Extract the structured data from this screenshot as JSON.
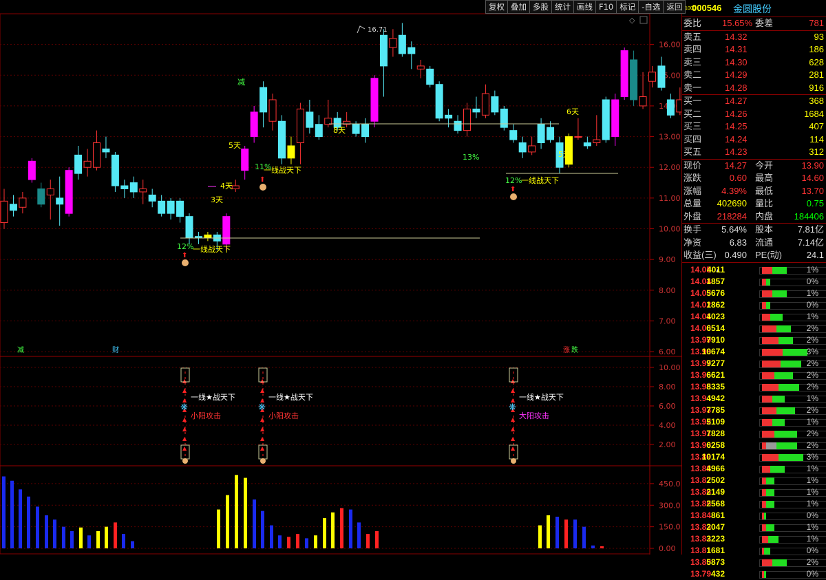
{
  "toolbar": [
    "复权",
    "叠加",
    "多股",
    "统计",
    "画线",
    "F10",
    "标记",
    "-自选",
    "返回"
  ],
  "chart": {
    "peak_label": "16.71",
    "price_axis": [
      "16.00",
      "15.00",
      "14.00",
      "13.00",
      "12.00",
      "11.00",
      "10.00",
      "9.00",
      "8.00",
      "7.00",
      "6.00"
    ],
    "annotations": [
      {
        "text": "12%",
        "color": "#4f4"
      },
      {
        "text": "一线战天下",
        "color": "#ff0"
      },
      {
        "text": "3天",
        "color": "#ff0"
      },
      {
        "text": "4天",
        "color": "#ff0"
      },
      {
        "text": "5天",
        "color": "#ff0"
      },
      {
        "text": "减",
        "color": "#4f4"
      },
      {
        "text": "11%",
        "color": "#4f4"
      },
      {
        "text": "一线战天下",
        "color": "#ff0"
      },
      {
        "text": "8天",
        "color": "#ff0"
      },
      {
        "text": "13%",
        "color": "#4f4"
      },
      {
        "text": "12%",
        "color": "#4f4"
      },
      {
        "text": "一线战天下",
        "color": "#ff0"
      },
      {
        "text": "5天",
        "color": "#ff0"
      },
      {
        "text": "6天",
        "color": "#ff0"
      }
    ],
    "bottom_markers": [
      {
        "text": "减",
        "color": "#4f4"
      },
      {
        "text": "财",
        "color": "#4cf"
      },
      {
        "text": "涨",
        "color": "#f33"
      },
      {
        "text": "跌",
        "color": "#4f4"
      }
    ],
    "indicator_axis": [
      "10.00",
      "8.00",
      "6.00",
      "4.00",
      "2.00"
    ],
    "signals": [
      {
        "line": "一线★战天下",
        "attack": "小阳攻击",
        "attack_color": "#f33"
      },
      {
        "line": "一线★战天下",
        "attack": "小阳攻击",
        "attack_color": "#f33"
      },
      {
        "line": "一线★战天下",
        "attack": "大阳攻击",
        "attack_color": "#f3f"
      }
    ],
    "volume_axis": [
      "450.0",
      "300.0",
      "150.0",
      "0.00"
    ]
  },
  "chart_data": {
    "type": "candlestick",
    "price_range": [
      5.8,
      17.0
    ],
    "candles": [
      {
        "o": 10.2,
        "c": 10.9,
        "h": 11.3,
        "l": 10.0,
        "k": "up"
      },
      {
        "o": 10.6,
        "c": 10.8,
        "h": 11.1,
        "l": 10.4,
        "k": "down"
      },
      {
        "o": 10.7,
        "c": 11.0,
        "h": 11.2,
        "l": 10.5,
        "k": "up"
      },
      {
        "o": 11.6,
        "c": 12.2,
        "h": 12.3,
        "l": 11.5,
        "k": "mag"
      },
      {
        "o": 11.3,
        "c": 10.8,
        "h": 11.5,
        "l": 10.7,
        "k": "teal"
      },
      {
        "o": 11.1,
        "c": 11.3,
        "h": 11.6,
        "l": 10.3,
        "k": "up"
      },
      {
        "o": 10.8,
        "c": 11.0,
        "h": 11.7,
        "l": 10.1,
        "k": "down"
      },
      {
        "o": 10.5,
        "c": 11.9,
        "h": 12.0,
        "l": 10.4,
        "k": "mag"
      },
      {
        "o": 11.8,
        "c": 12.4,
        "h": 12.7,
        "l": 11.6,
        "k": "down"
      },
      {
        "o": 12.2,
        "c": 12.0,
        "h": 12.6,
        "l": 11.7,
        "k": "up"
      },
      {
        "o": 12.0,
        "c": 12.8,
        "h": 13.2,
        "l": 11.9,
        "k": "up"
      },
      {
        "o": 12.5,
        "c": 12.6,
        "h": 13.0,
        "l": 12.3,
        "k": "down"
      },
      {
        "o": 12.4,
        "c": 11.4,
        "h": 12.5,
        "l": 11.2,
        "k": "down"
      },
      {
        "o": 11.3,
        "c": 11.4,
        "h": 11.6,
        "l": 11.0,
        "k": "down"
      },
      {
        "o": 11.2,
        "c": 11.5,
        "h": 11.7,
        "l": 11.0,
        "k": "down"
      },
      {
        "o": 11.3,
        "c": 11.2,
        "h": 11.6,
        "l": 10.8,
        "k": "up"
      },
      {
        "o": 11.1,
        "c": 10.9,
        "h": 11.3,
        "l": 10.7,
        "k": "down"
      },
      {
        "o": 10.9,
        "c": 10.5,
        "h": 11.1,
        "l": 10.4,
        "k": "down"
      },
      {
        "o": 10.5,
        "c": 10.9,
        "h": 11.0,
        "l": 10.3,
        "k": "down"
      },
      {
        "o": 10.9,
        "c": 10.4,
        "h": 11.0,
        "l": 10.2,
        "k": "down"
      },
      {
        "o": 10.4,
        "c": 9.7,
        "h": 10.5,
        "l": 9.5,
        "k": "down"
      },
      {
        "o": 9.7,
        "c": 9.75,
        "h": 9.9,
        "l": 9.5,
        "k": "down"
      },
      {
        "o": 9.7,
        "c": 9.8,
        "h": 9.9,
        "l": 9.6,
        "k": "yel"
      },
      {
        "o": 9.8,
        "c": 9.6,
        "h": 9.9,
        "l": 9.3,
        "k": "down"
      },
      {
        "o": 9.5,
        "c": 10.4,
        "h": 10.5,
        "l": 9.3,
        "k": "mag"
      },
      {
        "o": 11.3,
        "c": 11.4,
        "h": 11.6,
        "l": 11.2,
        "k": "up"
      },
      {
        "o": 11.9,
        "c": 12.6,
        "h": 12.7,
        "l": 11.6,
        "k": "mag"
      },
      {
        "o": 13.0,
        "c": 13.8,
        "h": 14.0,
        "l": 12.8,
        "k": "mag"
      },
      {
        "o": 13.8,
        "c": 14.6,
        "h": 14.8,
        "l": 13.3,
        "k": "down"
      },
      {
        "o": 14.2,
        "c": 13.5,
        "h": 14.4,
        "l": 13.2,
        "k": "up"
      },
      {
        "o": 13.5,
        "c": 12.3,
        "h": 13.7,
        "l": 12.1,
        "k": "down"
      },
      {
        "o": 12.3,
        "c": 12.7,
        "h": 13.0,
        "l": 12.1,
        "k": "yel"
      },
      {
        "o": 12.8,
        "c": 13.9,
        "h": 14.1,
        "l": 12.1,
        "k": "up"
      },
      {
        "o": 13.8,
        "c": 13.3,
        "h": 14.2,
        "l": 13.1,
        "k": "down"
      },
      {
        "o": 13.0,
        "c": 13.4,
        "h": 13.7,
        "l": 12.9,
        "k": "down"
      },
      {
        "o": 13.6,
        "c": 13.4,
        "h": 14.2,
        "l": 13.3,
        "k": "up"
      },
      {
        "o": 13.3,
        "c": 13.6,
        "h": 13.8,
        "l": 13.2,
        "k": "down"
      },
      {
        "o": 13.5,
        "c": 13.4,
        "h": 13.8,
        "l": 13.3,
        "k": "up"
      },
      {
        "o": 13.1,
        "c": 13.4,
        "h": 13.5,
        "l": 13.0,
        "k": "down"
      },
      {
        "o": 13.4,
        "c": 13.0,
        "h": 13.6,
        "l": 12.8,
        "k": "down"
      },
      {
        "o": 13.5,
        "c": 14.9,
        "h": 15.0,
        "l": 13.3,
        "k": "mag"
      },
      {
        "o": 15.3,
        "c": 16.3,
        "h": 16.5,
        "l": 14.3,
        "k": "down"
      },
      {
        "o": 15.9,
        "c": 16.2,
        "h": 16.5,
        "l": 15.6,
        "k": "up"
      },
      {
        "o": 16.3,
        "c": 15.7,
        "h": 16.7,
        "l": 15.6,
        "k": "down"
      },
      {
        "o": 15.7,
        "c": 15.9,
        "h": 16.1,
        "l": 15.2,
        "k": "down"
      },
      {
        "o": 15.3,
        "c": 15.2,
        "h": 15.5,
        "l": 14.9,
        "k": "up"
      },
      {
        "o": 15.2,
        "c": 14.7,
        "h": 15.3,
        "l": 14.6,
        "k": "down"
      },
      {
        "o": 14.7,
        "c": 13.6,
        "h": 14.8,
        "l": 13.5,
        "k": "down"
      },
      {
        "o": 13.6,
        "c": 13.7,
        "h": 13.9,
        "l": 13.3,
        "k": "down"
      },
      {
        "o": 13.5,
        "c": 13.2,
        "h": 13.7,
        "l": 13.1,
        "k": "down"
      },
      {
        "o": 13.2,
        "c": 13.9,
        "h": 14.1,
        "l": 13.0,
        "k": "up"
      },
      {
        "o": 13.8,
        "c": 13.9,
        "h": 14.3,
        "l": 13.6,
        "k": "down"
      },
      {
        "o": 13.7,
        "c": 14.4,
        "h": 14.7,
        "l": 13.6,
        "k": "up"
      },
      {
        "o": 14.3,
        "c": 13.8,
        "h": 14.5,
        "l": 13.7,
        "k": "down"
      },
      {
        "o": 13.9,
        "c": 13.3,
        "h": 14.0,
        "l": 13.2,
        "k": "down"
      },
      {
        "o": 13.2,
        "c": 12.9,
        "h": 13.4,
        "l": 12.8,
        "k": "down"
      },
      {
        "o": 12.8,
        "c": 12.5,
        "h": 13.0,
        "l": 12.3,
        "k": "down"
      },
      {
        "o": 12.5,
        "c": 12.7,
        "h": 13.0,
        "l": 12.4,
        "k": "up"
      },
      {
        "o": 12.8,
        "c": 13.4,
        "h": 13.6,
        "l": 12.6,
        "k": "down"
      },
      {
        "o": 13.3,
        "c": 12.9,
        "h": 13.5,
        "l": 12.8,
        "k": "down"
      },
      {
        "o": 12.8,
        "c": 12.0,
        "h": 13.0,
        "l": 11.8,
        "k": "down"
      },
      {
        "o": 12.1,
        "c": 13.0,
        "h": 13.1,
        "l": 12.0,
        "k": "yel"
      },
      {
        "o": 13.0,
        "c": 13.0,
        "h": 13.6,
        "l": 12.9,
        "k": "up"
      },
      {
        "o": 12.8,
        "c": 12.7,
        "h": 13.0,
        "l": 12.6,
        "k": "down"
      },
      {
        "o": 12.8,
        "c": 12.9,
        "h": 13.7,
        "l": 12.7,
        "k": "up"
      },
      {
        "o": 12.9,
        "c": 14.2,
        "h": 14.3,
        "l": 12.8,
        "k": "down"
      },
      {
        "o": 13.0,
        "c": 14.2,
        "h": 14.4,
        "l": 12.7,
        "k": "mag"
      },
      {
        "o": 14.3,
        "c": 15.8,
        "h": 15.9,
        "l": 14.2,
        "k": "mag"
      },
      {
        "o": 15.5,
        "c": 14.2,
        "h": 15.8,
        "l": 14.0,
        "k": "teal"
      },
      {
        "o": 14.0,
        "c": 14.3,
        "h": 15.1,
        "l": 13.9,
        "k": "up"
      },
      {
        "o": 14.8,
        "c": 15.1,
        "h": 15.3,
        "l": 14.6,
        "k": "up"
      },
      {
        "o": 14.6,
        "c": 15.3,
        "h": 15.6,
        "l": 14.5,
        "k": "down"
      },
      {
        "o": 14.2,
        "c": 13.7,
        "h": 14.4,
        "l": 13.6,
        "k": "down"
      },
      {
        "o": 13.8,
        "c": 14.2,
        "h": 14.6,
        "l": 13.7,
        "k": "up"
      }
    ],
    "volume_range": [
      0,
      550
    ],
    "volume": [
      {
        "v": 500,
        "c": "blue"
      },
      {
        "v": 470,
        "c": "blue"
      },
      {
        "v": 410,
        "c": "blue"
      },
      {
        "v": 360,
        "c": "blue"
      },
      {
        "v": 290,
        "c": "blue"
      },
      {
        "v": 230,
        "c": "blue"
      },
      {
        "v": 200,
        "c": "blue"
      },
      {
        "v": 150,
        "c": "blue"
      },
      {
        "v": 120,
        "c": "blue"
      },
      {
        "v": 145,
        "c": "yel"
      },
      {
        "v": 90,
        "c": "blue"
      },
      {
        "v": 120,
        "c": "yel"
      },
      {
        "v": 150,
        "c": "yel"
      },
      {
        "v": 180,
        "c": "red"
      },
      {
        "v": 100,
        "c": "blue"
      },
      {
        "v": 50,
        "c": "blue"
      },
      {
        "v": 270,
        "c": "yel"
      },
      {
        "v": 370,
        "c": "yel"
      },
      {
        "v": 510,
        "c": "yel"
      },
      {
        "v": 490,
        "c": "yel"
      },
      {
        "v": 340,
        "c": "blue"
      },
      {
        "v": 260,
        "c": "blue"
      },
      {
        "v": 160,
        "c": "blue"
      },
      {
        "v": 90,
        "c": "blue"
      },
      {
        "v": 80,
        "c": "red"
      },
      {
        "v": 100,
        "c": "red"
      },
      {
        "v": 70,
        "c": "blue"
      },
      {
        "v": 90,
        "c": "yel"
      },
      {
        "v": 210,
        "c": "yel"
      },
      {
        "v": 250,
        "c": "yel"
      },
      {
        "v": 280,
        "c": "red"
      },
      {
        "v": 270,
        "c": "blue"
      },
      {
        "v": 180,
        "c": "blue"
      },
      {
        "v": 100,
        "c": "red"
      },
      {
        "v": 120,
        "c": "red"
      },
      {
        "v": 160,
        "c": "yel"
      },
      {
        "v": 230,
        "c": "yel"
      },
      {
        "v": 220,
        "c": "blue"
      },
      {
        "v": 200,
        "c": "red"
      },
      {
        "v": 200,
        "c": "blue"
      },
      {
        "v": 150,
        "c": "blue"
      },
      {
        "v": 20,
        "c": "blue"
      },
      {
        "v": 15,
        "c": "red"
      }
    ]
  },
  "panel": {
    "code": "000546",
    "name": "金圆股份",
    "mini": "1000",
    "ratio": {
      "label": "委比",
      "value": "15.65%",
      "label2": "委差",
      "value2": "781"
    },
    "asks": [
      {
        "label": "卖五",
        "price": "14.32",
        "vol": "93"
      },
      {
        "label": "卖四",
        "price": "14.31",
        "vol": "186"
      },
      {
        "label": "卖三",
        "price": "14.30",
        "vol": "628"
      },
      {
        "label": "卖二",
        "price": "14.29",
        "vol": "281"
      },
      {
        "label": "卖一",
        "price": "14.28",
        "vol": "916"
      }
    ],
    "bids": [
      {
        "label": "买一",
        "price": "14.27",
        "vol": "368"
      },
      {
        "label": "买二",
        "price": "14.26",
        "vol": "1684"
      },
      {
        "label": "买三",
        "price": "14.25",
        "vol": "407"
      },
      {
        "label": "买四",
        "price": "14.24",
        "vol": "114"
      },
      {
        "label": "买五",
        "price": "14.23",
        "vol": "312"
      }
    ],
    "quote": [
      {
        "l1": "现价",
        "v1": "14.27",
        "c1": "r",
        "l2": "今开",
        "v2": "13.90",
        "c2": "r"
      },
      {
        "l1": "涨跌",
        "v1": "0.60",
        "c1": "r",
        "l2": "最高",
        "v2": "14.60",
        "c2": "r"
      },
      {
        "l1": "涨幅",
        "v1": "4.39%",
        "c1": "r",
        "l2": "最低",
        "v2": "13.70",
        "c2": "r"
      },
      {
        "l1": "总量",
        "v1": "402690",
        "c1": "y",
        "l2": "量比",
        "v2": "0.75",
        "c2": "g"
      },
      {
        "l1": "外盘",
        "v1": "218284",
        "c1": "r",
        "l2": "内盘",
        "v2": "184406",
        "c2": "g"
      }
    ],
    "fund": [
      {
        "l1": "换手",
        "v1": "5.64%",
        "l2": "股本",
        "v2": "7.81亿"
      },
      {
        "l1": "净资",
        "v1": "6.83",
        "l2": "流通",
        "v2": "7.14亿"
      },
      {
        "l1": "收益(三)",
        "v1": "0.490",
        "l2": "PE(动)",
        "v2": "24.1"
      }
    ],
    "trades": [
      {
        "p": "14.05",
        "v": "4011",
        "pct": "1%",
        "r": 0.25,
        "g": 0.35,
        "mark": "▲"
      },
      {
        "p": "14.04",
        "v": "1857",
        "pct": "0%",
        "r": 0.1,
        "g": 0.1
      },
      {
        "p": "14.03",
        "v": "5676",
        "pct": "1%",
        "r": 0.25,
        "g": 0.35
      },
      {
        "p": "14.02",
        "v": "1862",
        "pct": "0%",
        "r": 0.1,
        "g": 0.1
      },
      {
        "p": "14.01",
        "v": "4023",
        "pct": "1%",
        "r": 0.2,
        "g": 0.3
      },
      {
        "p": "14.00",
        "v": "6514",
        "pct": "2%",
        "r": 0.35,
        "g": 0.35
      },
      {
        "p": "13.99",
        "v": "7910",
        "pct": "2%",
        "r": 0.4,
        "g": 0.35
      },
      {
        "p": "13.98",
        "v": "10674",
        "pct": "3%",
        "r": 0.5,
        "g": 0.6
      },
      {
        "p": "13.97",
        "v": "9277",
        "pct": "2%",
        "r": 0.45,
        "g": 0.5
      },
      {
        "p": "13.96",
        "v": "6621",
        "pct": "2%",
        "r": 0.3,
        "g": 0.45
      },
      {
        "p": "13.95",
        "v": "8335",
        "pct": "2%",
        "r": 0.4,
        "g": 0.5
      },
      {
        "p": "13.94",
        "v": "4942",
        "pct": "1%",
        "r": 0.25,
        "g": 0.3
      },
      {
        "p": "13.93",
        "v": "7785",
        "pct": "2%",
        "r": 0.35,
        "g": 0.45
      },
      {
        "p": "13.92",
        "v": "5109",
        "pct": "1%",
        "r": 0.25,
        "g": 0.3
      },
      {
        "p": "13.91",
        "v": "7828",
        "pct": "2%",
        "r": 0.3,
        "g": 0.55
      },
      {
        "p": "13.90",
        "v": "6258",
        "pct": "2%",
        "r": 0.1,
        "g": 0.5,
        "gray": 0.25
      },
      {
        "p": "13.89",
        "v": "10174",
        "pct": "3%",
        "r": 0.4,
        "g": 0.6
      },
      {
        "p": "13.88",
        "v": "4966",
        "pct": "1%",
        "r": 0.2,
        "g": 0.35
      },
      {
        "p": "13.87",
        "v": "2502",
        "pct": "1%",
        "r": 0.1,
        "g": 0.2
      },
      {
        "p": "13.86",
        "v": "2149",
        "pct": "1%",
        "r": 0.1,
        "g": 0.2
      },
      {
        "p": "13.85",
        "v": "2568",
        "pct": "1%",
        "r": 0.1,
        "g": 0.2
      },
      {
        "p": "13.84",
        "v": "861",
        "pct": "0%",
        "r": 0.05,
        "g": 0.05
      },
      {
        "p": "13.83",
        "v": "2047",
        "pct": "1%",
        "r": 0.1,
        "g": 0.2
      },
      {
        "p": "13.82",
        "v": "3223",
        "pct": "1%",
        "r": 0.15,
        "g": 0.25
      },
      {
        "p": "13.81",
        "v": "1681",
        "pct": "0%",
        "r": 0.05,
        "g": 0.15
      },
      {
        "p": "13.80",
        "v": "5873",
        "pct": "2%",
        "r": 0.25,
        "g": 0.35
      },
      {
        "p": "13.79",
        "v": "432",
        "pct": "0%",
        "r": 0.05,
        "g": 0.05
      }
    ]
  }
}
